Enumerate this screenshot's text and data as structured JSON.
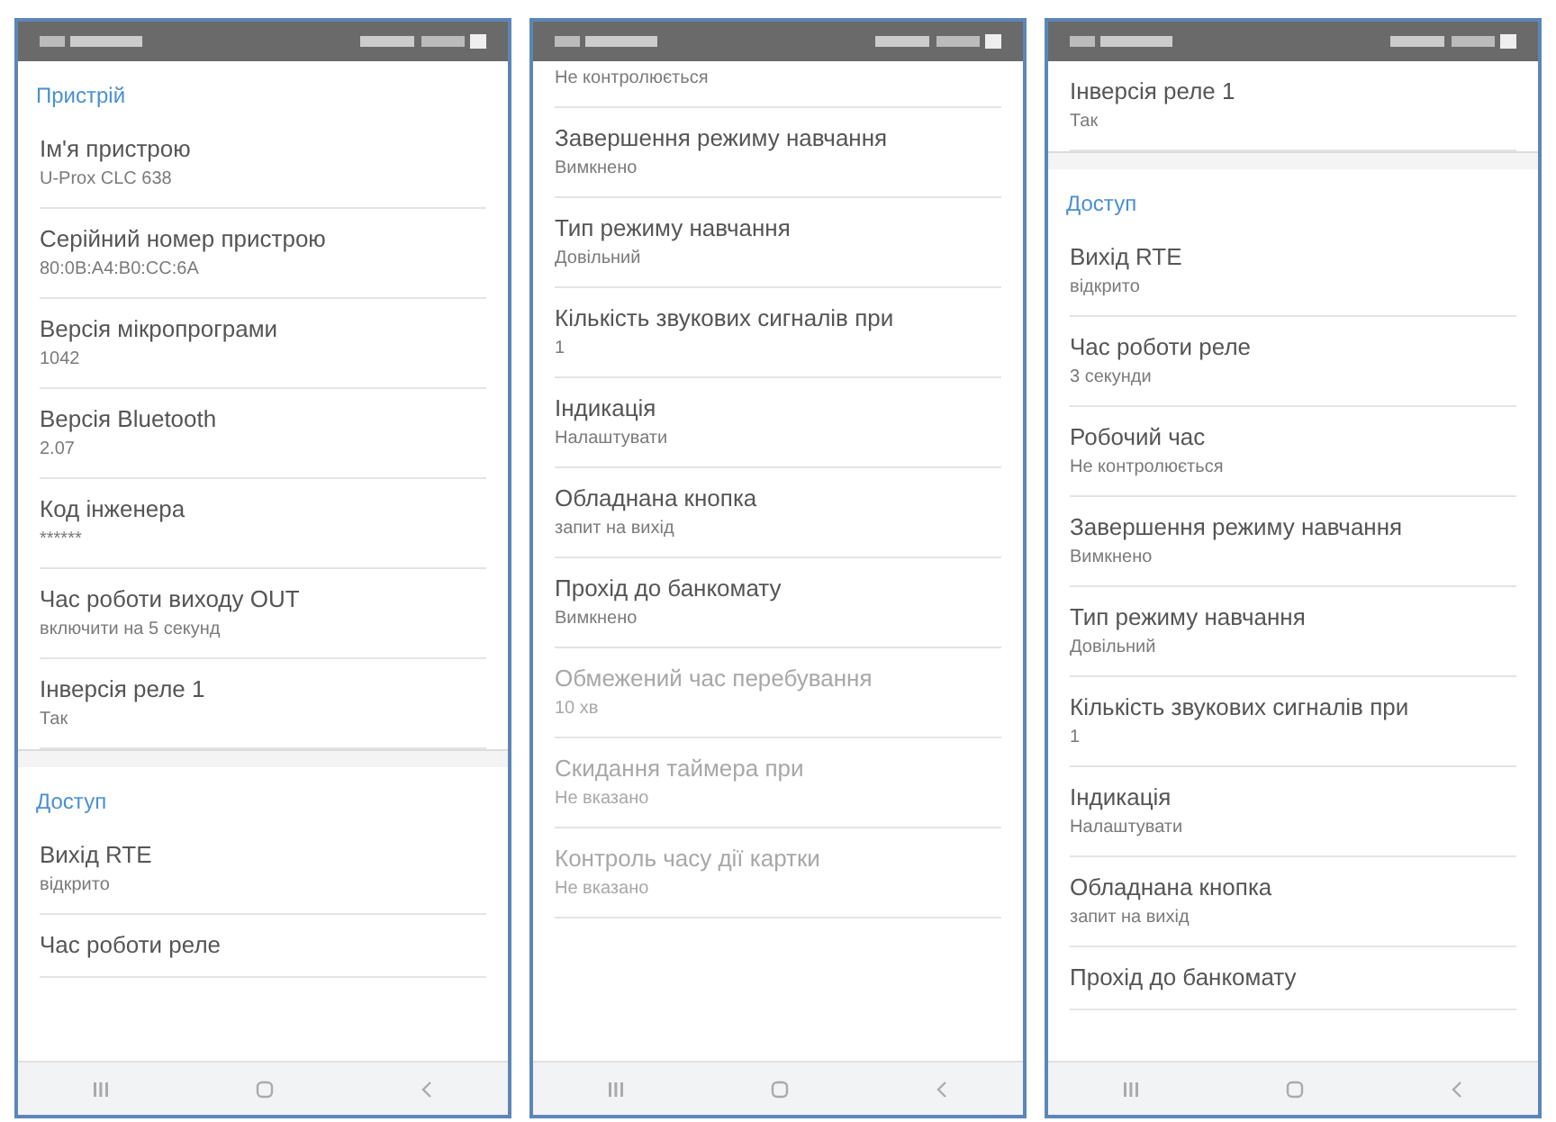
{
  "phones": [
    {
      "content": [
        {
          "kind": "section",
          "label": "Пристрій"
        },
        {
          "kind": "item",
          "title": "Ім'я пристрою",
          "value": "U-Prox CLC 638",
          "disabled": false
        },
        {
          "kind": "item",
          "title": "Серійний номер пристрою",
          "value": "80:0B:A4:B0:CC:6A",
          "disabled": false
        },
        {
          "kind": "item",
          "title": "Версія мікропрограми",
          "value": "1042",
          "disabled": false
        },
        {
          "kind": "item",
          "title": "Версія Bluetooth",
          "value": "2.07",
          "disabled": false
        },
        {
          "kind": "item",
          "title": "Код інженера",
          "value": "******",
          "disabled": false
        },
        {
          "kind": "item",
          "title": "Час роботи виходу OUT",
          "value": "включити на 5 секунд",
          "disabled": false
        },
        {
          "kind": "item",
          "title": "Інверсія реле 1",
          "value": "Так",
          "disabled": false
        },
        {
          "kind": "gap"
        },
        {
          "kind": "section",
          "label": "Доступ"
        },
        {
          "kind": "item",
          "title": "Вихід RTE",
          "value": "відкрито",
          "disabled": false
        },
        {
          "kind": "item",
          "title": "Час роботи реле",
          "disabled": false
        }
      ]
    },
    {
      "content": [
        {
          "kind": "item",
          "value": "Не контролюється",
          "disabled": false
        },
        {
          "kind": "item",
          "title": "Завершення режиму навчання",
          "value": "Вимкнено",
          "disabled": false
        },
        {
          "kind": "item",
          "title": "Тип режиму навчання",
          "value": "Довільний",
          "disabled": false
        },
        {
          "kind": "item",
          "title": "Кількість звукових сигналів при",
          "value": "1",
          "disabled": false
        },
        {
          "kind": "item",
          "title": "Індикація",
          "value": "Налаштувати",
          "disabled": false
        },
        {
          "kind": "item",
          "title": "Обладнана кнопка",
          "value": "запит на вихід",
          "disabled": false
        },
        {
          "kind": "item",
          "title": "Прохід до банкомату",
          "value": "Вимкнено",
          "disabled": false
        },
        {
          "kind": "item",
          "title": "Обмежений час перебування",
          "value": "10 хв",
          "disabled": true
        },
        {
          "kind": "item",
          "title": "Скидання таймера при",
          "value": "Не вказано",
          "disabled": true
        },
        {
          "kind": "item",
          "title": "Контроль часу дії картки",
          "value": "Не вказано",
          "disabled": true
        }
      ]
    },
    {
      "content": [
        {
          "kind": "item",
          "title": "Інверсія реле 1",
          "value": "Так",
          "disabled": false
        },
        {
          "kind": "gap"
        },
        {
          "kind": "section",
          "label": "Доступ"
        },
        {
          "kind": "item",
          "title": "Вихід RTE",
          "value": "відкрито",
          "disabled": false
        },
        {
          "kind": "item",
          "title": "Час роботи реле",
          "value": "3 секунди",
          "disabled": false
        },
        {
          "kind": "item",
          "title": "Робочий час",
          "value": "Не контролюється",
          "disabled": false
        },
        {
          "kind": "item",
          "title": "Завершення режиму навчання",
          "value": "Вимкнено",
          "disabled": false
        },
        {
          "kind": "item",
          "title": "Тип режиму навчання",
          "value": "Довільний",
          "disabled": false
        },
        {
          "kind": "item",
          "title": "Кількість звукових сигналів при",
          "value": "1",
          "disabled": false
        },
        {
          "kind": "item",
          "title": "Індикація",
          "value": "Налаштувати",
          "disabled": false
        },
        {
          "kind": "item",
          "title": "Обладнана кнопка",
          "value": "запит на вихід",
          "disabled": false
        },
        {
          "kind": "item",
          "title": "Прохід до банкомату",
          "disabled": false
        }
      ]
    }
  ]
}
